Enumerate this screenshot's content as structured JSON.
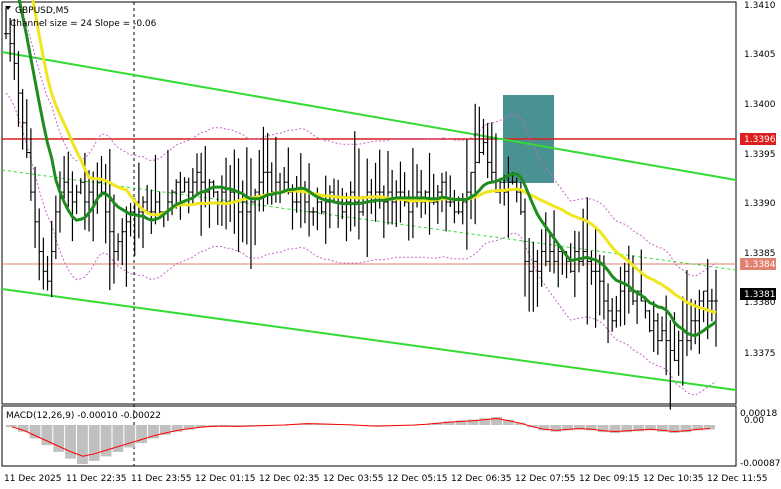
{
  "header": {
    "symbol": "GBPUSD,M5",
    "indicator": "Channel size = 24 Slope = -0.06"
  },
  "macd": {
    "label": "MACD(12,26,9) -0.00010 -0.00022",
    "axis": [
      "0.00018",
      "0.00",
      "-0.00087"
    ],
    "hist_color": "#c0c0c0",
    "signal_color": "#ff0000"
  },
  "price_axis": {
    "ticks": [
      "1.3410",
      "1.3405",
      "1.3400",
      "1.3395",
      "1.3390",
      "1.3385",
      "1.3380",
      "1.3375"
    ],
    "tags": {
      "resistance": "1.3396",
      "support": "1.3384",
      "current": "1.3381"
    }
  },
  "time_axis": [
    "11 Dec 2025",
    "11 Dec 22:35",
    "11 Dec 23:55",
    "12 Dec 01:15",
    "12 Dec 02:35",
    "12 Dec 03:55",
    "12 Dec 05:15",
    "12 Dec 06:35",
    "12 Dec 07:55",
    "12 Dec 09:15",
    "12 Dec 10:35",
    "12 Dec 11:55"
  ],
  "colors": {
    "bars": "#000000",
    "ma_fast": "#1e8c1e",
    "ma_slow": "#f0e61e",
    "channel": "#32dc32",
    "level_red": "#dc1e1e",
    "level_orange": "#e0826e",
    "envelope": "#c864c8",
    "highlight": "#2a7f7f"
  },
  "chart_data": {
    "type": "line",
    "title": "GBPUSD,M5",
    "ylim": [
      1.3371,
      1.3411
    ],
    "x_count": 170,
    "ohlc_close_approx": [
      1.3408,
      1.3407,
      1.3405,
      1.3402,
      1.3399,
      1.3396,
      1.3392,
      1.3389,
      1.3386,
      1.3384,
      1.3383,
      1.3386,
      1.339,
      1.3392,
      1.3393,
      1.3392,
      1.3391,
      1.3392,
      1.3393,
      1.3391,
      1.3392,
      1.3391,
      1.3393,
      1.3392,
      1.339,
      1.3388,
      1.3386,
      1.3387,
      1.3388,
      1.3389,
      1.339,
      1.3391,
      1.339,
      1.3391,
      1.339,
      1.339,
      1.3391,
      1.339,
      1.339,
      1.3391,
      1.3392,
      1.3393,
      1.3392,
      1.3393,
      1.3392,
      1.3393,
      1.3394,
      1.3393,
      1.3392,
      1.3393,
      1.3392,
      1.3391,
      1.3392,
      1.3391,
      1.3392,
      1.3391,
      1.339,
      1.3391,
      1.339,
      1.3391,
      1.3392,
      1.3393,
      1.3394,
      1.3394,
      1.3392,
      1.3393,
      1.3392,
      1.3393,
      1.3392,
      1.3391,
      1.3391,
      1.3392,
      1.3391,
      1.339,
      1.339,
      1.3391,
      1.339,
      1.3391,
      1.3392,
      1.3391,
      1.3391,
      1.339,
      1.3391,
      1.3392,
      1.3391,
      1.339,
      1.3391,
      1.3392,
      1.3391,
      1.3392,
      1.3392,
      1.3391,
      1.3392,
      1.3391,
      1.3392,
      1.3392,
      1.3391,
      1.339,
      1.3391,
      1.3392,
      1.3391,
      1.3392,
      1.3391,
      1.3391,
      1.3392,
      1.3393,
      1.3391,
      1.3391,
      1.339,
      1.339,
      1.3391,
      1.3392,
      1.3394,
      1.3395,
      1.3396,
      1.3397,
      1.3395,
      1.3394,
      1.3392,
      1.3393,
      1.3392,
      1.3393,
      1.3393,
      1.3392,
      1.339,
      1.3385,
      1.3384,
      1.3385,
      1.3384,
      1.3386,
      1.3385,
      1.3386,
      1.3385,
      1.3386,
      1.3386,
      1.3385,
      1.3384,
      1.3386,
      1.3385,
      1.3386,
      1.3385,
      1.3384,
      1.3384,
      1.3383,
      1.3381,
      1.338,
      1.3379,
      1.338,
      1.3382,
      1.3384,
      1.3382,
      1.3381,
      1.3382,
      1.3381,
      1.338,
      1.3378,
      1.3379,
      1.3377,
      1.3378,
      1.3377,
      1.3376,
      1.3375,
      1.3377,
      1.3378,
      1.3377,
      1.3379,
      1.3379,
      1.3381,
      1.3382,
      1.3381,
      1.3381,
      1.3381
    ],
    "series": [
      {
        "values_ref": "ma_fast"
      },
      {
        "values_ref": "ma_slow"
      }
    ],
    "levels": [
      1.3396,
      1.3384
    ],
    "macd_hist_approx": [
      -5e-05,
      -0.00015,
      -0.0003,
      -0.00045,
      -0.0006,
      -0.00075,
      -0.00087,
      -0.0008,
      -0.0007,
      -0.0006,
      -0.0005,
      -0.0004,
      -0.0003,
      -0.00022,
      -0.00015,
      -0.0001,
      -6e-05,
      -4e-05,
      -3e-05,
      -4e-05,
      -3e-05,
      -2e-05,
      -1e-05,
      0.0,
      2e-05,
      4e-05,
      3e-05,
      2e-05,
      1e-05,
      0.0,
      -2e-05,
      -3e-05,
      -2e-05,
      -1e-05,
      0.0,
      2e-05,
      5e-05,
      8e-05,
      0.0001,
      0.00012,
      0.00015,
      0.00018,
      0.00012,
      5e-05,
      -5e-05,
      -0.00012,
      -0.00015,
      -0.00012,
      -0.0001,
      -0.00012,
      -0.00016,
      -0.00018,
      -0.00016,
      -0.00014,
      -0.00012,
      -0.00015,
      -0.00018,
      -0.00016,
      -0.00012,
      -0.0001
    ]
  }
}
